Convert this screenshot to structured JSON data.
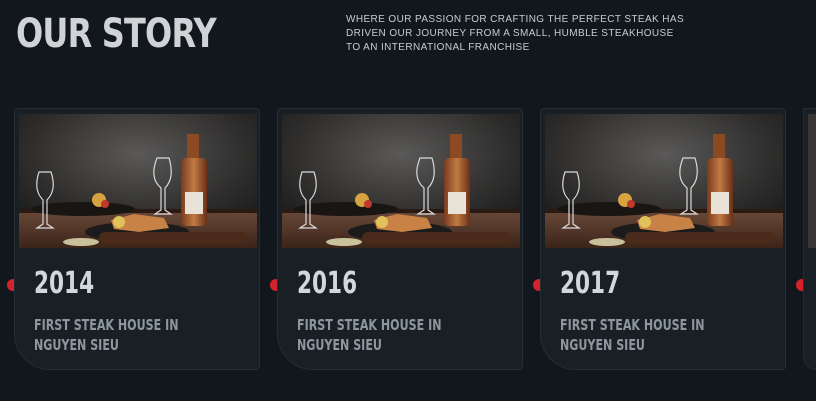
{
  "header": {
    "title": "OUR STORY",
    "intro_line1": "WHERE OUR PASSION FOR CRAFTING THE PERFECT STEAK HAS",
    "intro_line2": "DRIVEN OUR JOURNEY FROM A SMALL, HUMBLE STEAKHOUSE",
    "intro_line3": "TO AN INTERNATIONAL FRANCHISE"
  },
  "timeline": {
    "accent_color": "#d4222c",
    "items": [
      {
        "year": "2014",
        "caption_line1": "FIRST STEAK HOUSE IN",
        "caption_line2": "NGUYEN SIEU",
        "image": "steak-dinner-with-wine-photo"
      },
      {
        "year": "2016",
        "caption_line1": "FIRST STEAK HOUSE IN",
        "caption_line2": "NGUYEN SIEU",
        "image": "steak-dinner-with-wine-photo"
      },
      {
        "year": "2017",
        "caption_line1": "FIRST STEAK HOUSE IN",
        "caption_line2": "NGUYEN SIEU",
        "image": "steak-dinner-with-wine-photo"
      }
    ]
  }
}
